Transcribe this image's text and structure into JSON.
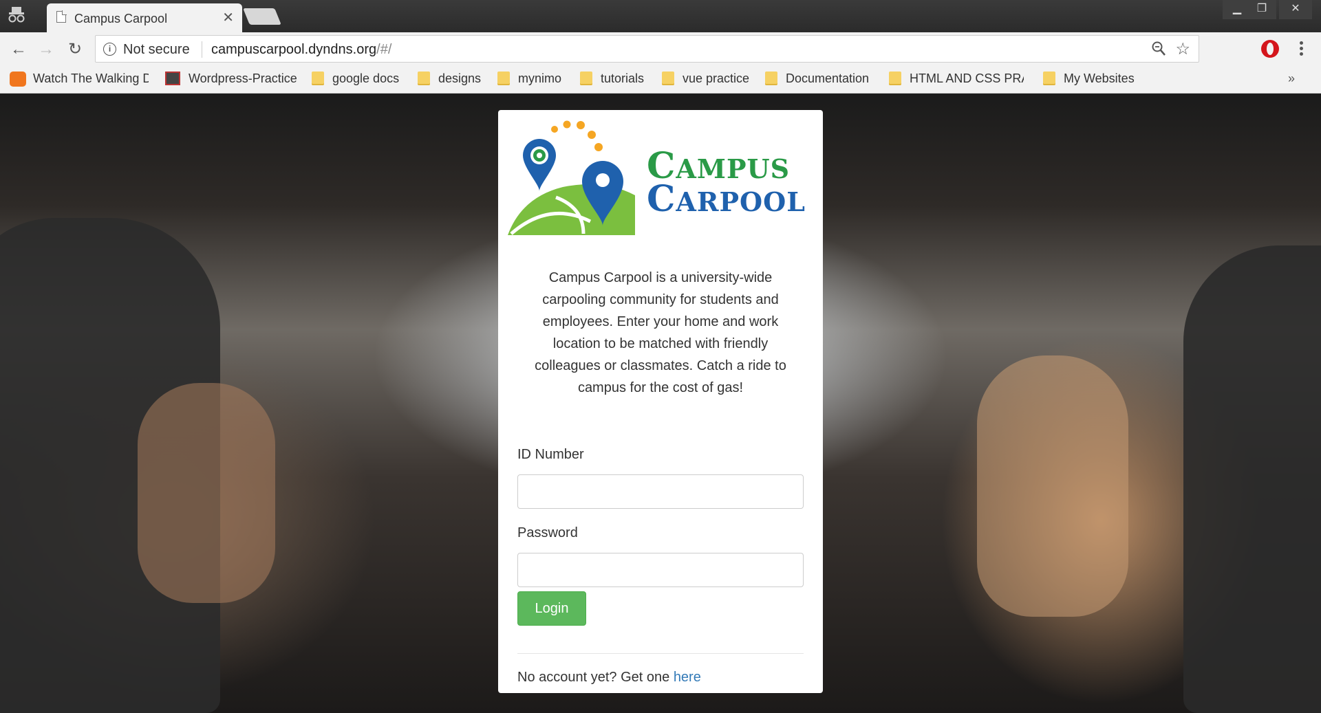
{
  "browser": {
    "tab": {
      "title": "Campus Carpool"
    },
    "toolbar": {
      "security_label": "Not secure",
      "url_host": "campuscarpool.dyndns.org",
      "url_path": "/#/"
    },
    "bookmarks": [
      {
        "label": "Watch The Walking D",
        "icon": "orange-favicon"
      },
      {
        "label": "Wordpress-Practice",
        "icon": "wordpress-favicon"
      },
      {
        "label": "google docs",
        "icon": "folder-icon"
      },
      {
        "label": "designs",
        "icon": "folder-icon"
      },
      {
        "label": "mynimo",
        "icon": "folder-icon"
      },
      {
        "label": "tutorials",
        "icon": "folder-icon"
      },
      {
        "label": "vue practice",
        "icon": "folder-icon"
      },
      {
        "label": "Documentation",
        "icon": "folder-icon"
      },
      {
        "label": "HTML AND CSS PRAC",
        "icon": "folder-icon"
      },
      {
        "label": "My Websites",
        "icon": "folder-icon"
      }
    ],
    "bookmarks_more": "»"
  },
  "login": {
    "logo": {
      "line1_initial": "C",
      "line1_rest": "AMPUS",
      "line2_initial": "C",
      "line2_rest": "ARPOOL"
    },
    "description": "Campus Carpool is a university-wide carpooling community for students and employees. Enter your home and work location to be matched with friendly colleagues or classmates. Catch a ride to campus for the cost of gas!",
    "id_label": "ID Number",
    "id_value": "",
    "password_label": "Password",
    "password_value": "",
    "login_button": "Login",
    "signup_text": "No account yet? Get one ",
    "signup_link": "here"
  },
  "colors": {
    "primary_button": "#5cb85c",
    "link": "#337ab7",
    "logo_green": "#2a9a47",
    "logo_blue": "#1f61ad"
  }
}
